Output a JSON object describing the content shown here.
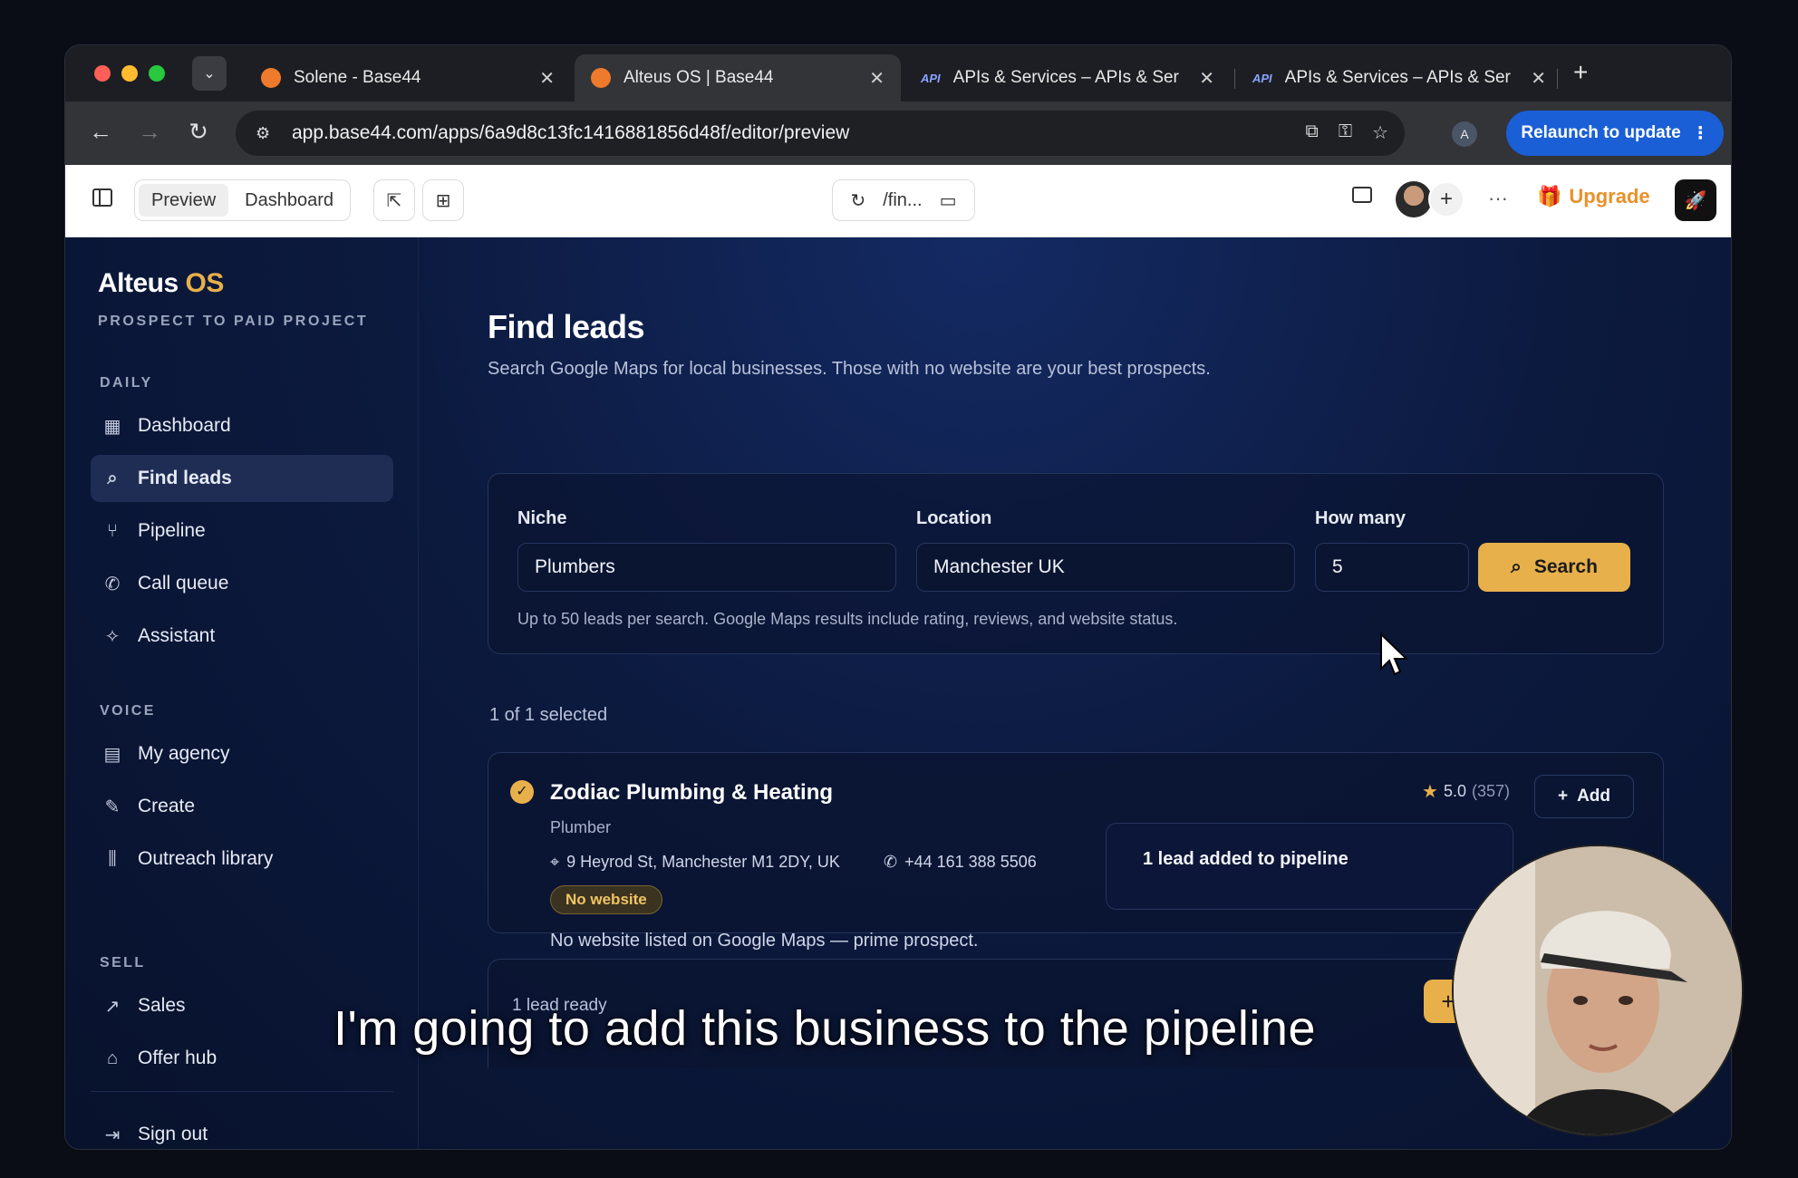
{
  "browser": {
    "tabs": [
      {
        "title": "Solene - Base44",
        "favicon": "base44-orange-icon",
        "active": false
      },
      {
        "title": "Alteus OS | Base44",
        "favicon": "base44-orange-icon",
        "active": true
      },
      {
        "title": "APIs & Services – APIs & Ser",
        "favicon": "api-icon",
        "active": false
      },
      {
        "title": "APIs & Services – APIs & Ser",
        "favicon": "api-icon",
        "active": false
      }
    ],
    "api_favicon_text": "API",
    "url": "app.base44.com/apps/6a9d8c13fc1416881856d48f/editor/preview",
    "profile_initial": "A",
    "relaunch_label": "Relaunch to update"
  },
  "editor": {
    "preview_label": "Preview",
    "dashboard_label": "Dashboard",
    "route_label": "/fin...",
    "upgrade_label": "Upgrade",
    "accent": "#e8912a"
  },
  "sidebar": {
    "brand_main": "Alteus",
    "brand_accent": "OS",
    "brand_sub": "PROSPECT TO PAID PROJECT",
    "sections": {
      "daily": "DAILY",
      "voice": "VOICE",
      "sell": "SELL"
    },
    "items": [
      {
        "label": "Dashboard",
        "icon": "grid-icon"
      },
      {
        "label": "Find leads",
        "icon": "search-icon",
        "active": true
      },
      {
        "label": "Pipeline",
        "icon": "branch-icon"
      },
      {
        "label": "Call queue",
        "icon": "phone-icon"
      },
      {
        "label": "Assistant",
        "icon": "sparkle-icon"
      },
      {
        "label": "My agency",
        "icon": "building-icon"
      },
      {
        "label": "Create",
        "icon": "pen-icon"
      },
      {
        "label": "Outreach library",
        "icon": "library-icon"
      },
      {
        "label": "Sales",
        "icon": "trend-icon"
      },
      {
        "label": "Offer hub",
        "icon": "tag-icon"
      }
    ],
    "sign_out": "Sign out",
    "brand_color": "#e8b04b"
  },
  "main": {
    "title": "Find leads",
    "subtitle": "Search Google Maps for local businesses. Those with no website are your best prospects.",
    "form": {
      "niche_label": "Niche",
      "niche_value": "Plumbers",
      "location_label": "Location",
      "location_value": "Manchester UK",
      "count_label": "How many",
      "count_value": "5",
      "search_label": "Search",
      "hint": "Up to 50 leads per search. Google Maps results include rating, reviews, and website status."
    },
    "selected_text": "1 of 1 selected",
    "leads": [
      {
        "name": "Zodiac Plumbing & Heating",
        "category": "Plumber",
        "address": "9 Heyrod St, Manchester M1 2DY, UK",
        "phone": "+44 161 388 5506",
        "badge": "No website",
        "note": "No website listed on Google Maps — prime prospect.",
        "rating": "5.0",
        "reviews": "(357)",
        "add_label": "Add"
      }
    ],
    "ready_text": "1 lead ready",
    "toast": "1 lead added to pipeline"
  },
  "overlay": {
    "subtitle": "I'm going to add this business to the pipeline"
  }
}
